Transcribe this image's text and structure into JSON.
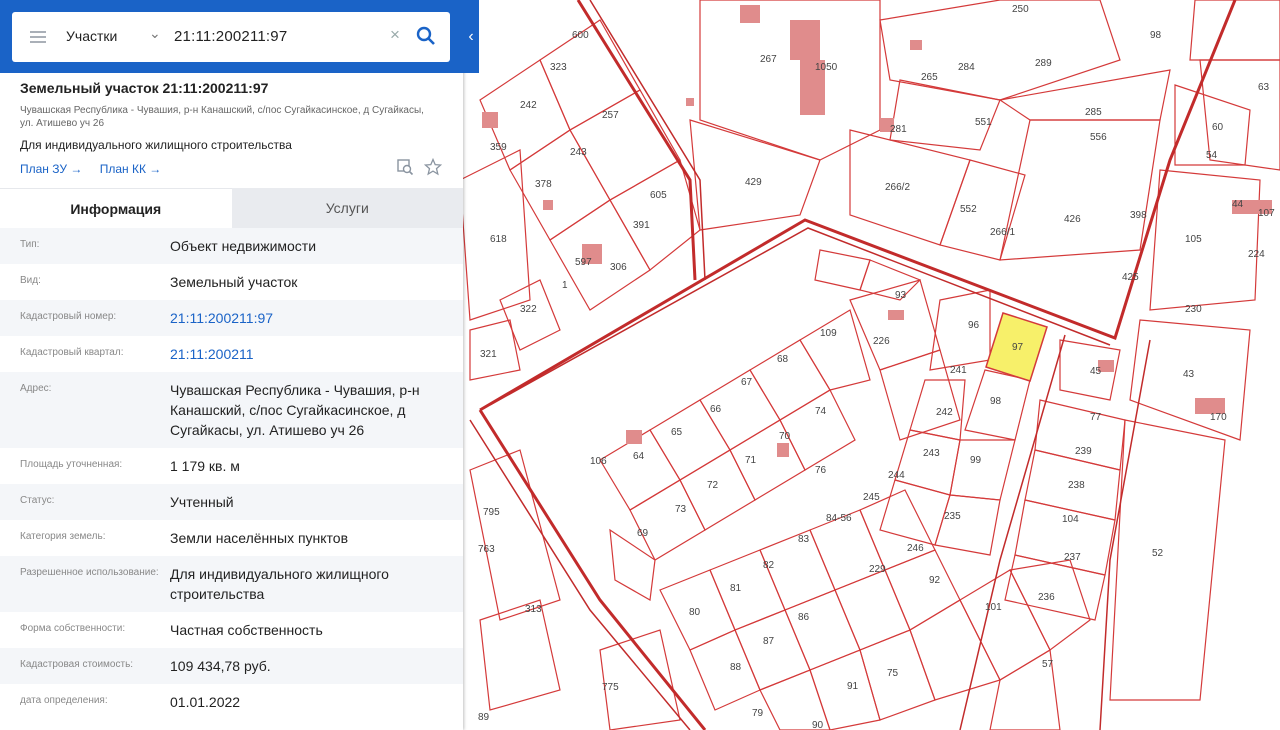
{
  "search": {
    "category": "Участки",
    "value": "21:11:200211:97"
  },
  "object": {
    "title": "Земельный участок 21:11:200211:97",
    "address_short": "Чувашская Республика - Чувашия, р-н Канашский, с/пос Сугайкасинское, д Сугайкасы, ул. Атишево уч 26",
    "purpose": "Для индивидуального жилищного строительства",
    "links": [
      "План ЗУ →",
      "План КК →"
    ]
  },
  "tabs": [
    "Информация",
    "Услуги"
  ],
  "info_rows": [
    {
      "label": "Тип:",
      "value": "Объект недвижимости"
    },
    {
      "label": "Вид:",
      "value": "Земельный участок"
    },
    {
      "label": "Кадастровый номер:",
      "value": "21:11:200211:97",
      "link": true
    },
    {
      "label": "Кадастровый квартал:",
      "value": "21:11:200211",
      "link": true
    },
    {
      "label": "Адрес:",
      "value": "Чувашская Республика - Чувашия, р-н Канашский, с/пос Сугайкасинское, д Сугайкасы, ул. Атишево уч 26"
    },
    {
      "label": "Площадь уточненная:",
      "value": "1 179 кв. м"
    },
    {
      "label": "Статус:",
      "value": "Учтенный"
    },
    {
      "label": "Категория земель:",
      "value": "Земли населённых пунктов"
    },
    {
      "label": "Разрешенное использование:",
      "value": "Для индивидуального жилищного строительства"
    },
    {
      "label": "Форма собственности:",
      "value": "Частная собственность"
    },
    {
      "label": "Кадастровая стоимость:",
      "value": "109 434,78 руб."
    },
    {
      "label": "дата определения:",
      "value": "01.01.2022"
    }
  ],
  "map": {
    "highlight_color": "#f7f06a",
    "line_color": "#d43a3a",
    "building_color": "#e08c8c",
    "parcel_labels": [
      "250",
      "98",
      "289",
      "284",
      "265",
      "267",
      "1050",
      "323",
      "600",
      "242",
      "257",
      "359",
      "243",
      "378",
      "605",
      "391",
      "429",
      "281",
      "551",
      "285",
      "556",
      "60",
      "54",
      "63",
      "266/2",
      "552",
      "266/1",
      "426",
      "398",
      "44",
      "107",
      "105",
      "224",
      "618",
      "597",
      "306",
      "1",
      "322",
      "321",
      "93",
      "226",
      "109",
      "68",
      "96",
      "97",
      "241",
      "45",
      "67",
      "242",
      "66",
      "74",
      "98",
      "65",
      "70",
      "64",
      "106",
      "71",
      "76",
      "243",
      "99",
      "244",
      "245",
      "77",
      "239",
      "238",
      "72",
      "73",
      "69",
      "235",
      "84-56",
      "104",
      "83",
      "246",
      "237",
      "229",
      "82",
      "81",
      "80",
      "86",
      "87",
      "88",
      "92",
      "101",
      "236",
      "52",
      "79",
      "313",
      "763",
      "795",
      "775",
      "89",
      "90",
      "91",
      "75",
      "57",
      "230",
      "43",
      "170",
      "425"
    ]
  }
}
